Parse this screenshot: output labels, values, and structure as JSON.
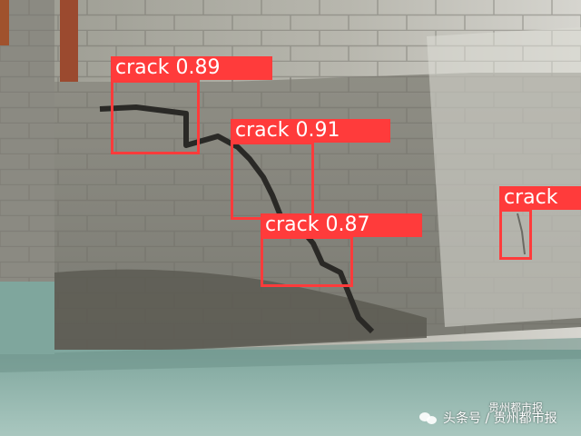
{
  "detections": [
    {
      "label": "crack 0.89"
    },
    {
      "label": "crack 0.91"
    },
    {
      "label": "crack 0.87"
    },
    {
      "label": "crack"
    }
  ],
  "watermark": {
    "text": "头条号 / 贵州都市报",
    "top_text": "贵州都市报"
  },
  "colors": {
    "box": "#ff3b3b",
    "label_text": "#ffffff"
  }
}
